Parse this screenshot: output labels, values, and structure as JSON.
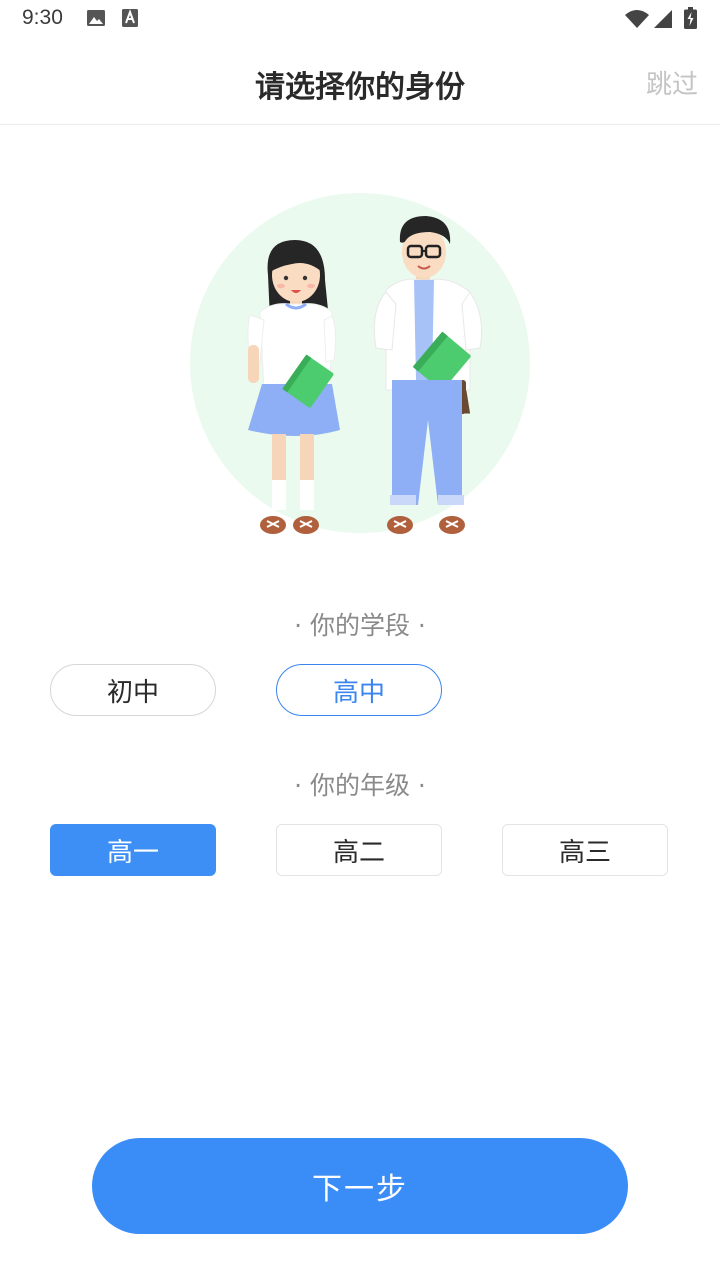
{
  "status_bar": {
    "time": "9:30",
    "icons": [
      "image-icon",
      "keyboard-a-icon",
      "wifi-icon",
      "signal-icon",
      "battery-charging-icon"
    ]
  },
  "header": {
    "title": "请选择你的身份",
    "skip_label": "跳过"
  },
  "stage_section": {
    "label": "· 你的学段 ·",
    "options": [
      {
        "label": "初中",
        "selected": false
      },
      {
        "label": "高中",
        "selected": true
      }
    ]
  },
  "grade_section": {
    "label": "· 你的年级 ·",
    "options": [
      {
        "label": "高一",
        "selected": true
      },
      {
        "label": "高二",
        "selected": false
      },
      {
        "label": "高三",
        "selected": false
      }
    ]
  },
  "next_button_label": "下一步",
  "colors": {
    "accent": "#3a8df7",
    "illustration_bg": "#eafaee",
    "skirt_pants": "#8eaef5",
    "book_green": "#4ccc6e"
  }
}
